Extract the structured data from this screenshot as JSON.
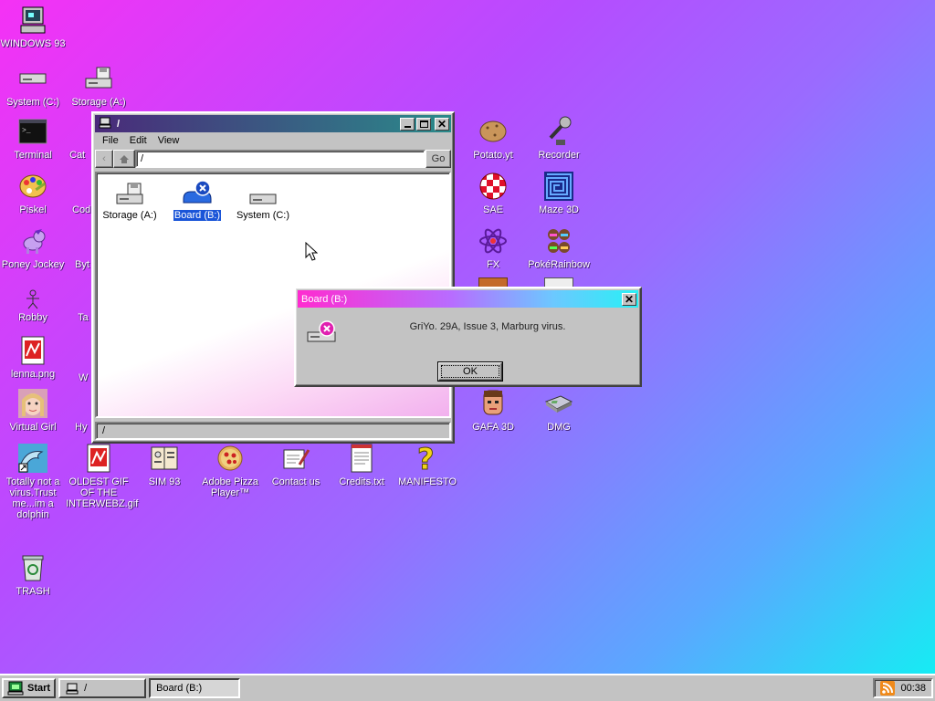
{
  "desktop": {
    "icons": [
      {
        "label": "WINDOWS 93",
        "icon": "computer-icon"
      },
      {
        "label": "System (C:)",
        "icon": "drive-icon"
      },
      {
        "label": "Storage (A:)",
        "icon": "floppy-drive-icon"
      },
      {
        "label": "Terminal",
        "icon": "terminal-icon"
      },
      {
        "label": "Cat",
        "icon": "cat-icon"
      },
      {
        "label": "Piskel",
        "icon": "palette-icon"
      },
      {
        "label": "Cod",
        "icon": "app-icon"
      },
      {
        "label": "Poney Jockey",
        "icon": "pony-icon"
      },
      {
        "label": "Byt",
        "icon": "app-icon"
      },
      {
        "label": "Robby",
        "icon": "stickman-icon"
      },
      {
        "label": "Ta",
        "icon": "app-icon"
      },
      {
        "label": "lenna.png",
        "icon": "image-file-icon"
      },
      {
        "label": "W",
        "icon": "app-icon"
      },
      {
        "label": "Virtual Girl",
        "icon": "face-icon"
      },
      {
        "label": "Hy",
        "icon": "app-icon"
      },
      {
        "label": "Totally not a virus.Trust me...im a dolphin",
        "icon": "dolphin-icon"
      },
      {
        "label": "OLDEST GIF OF THE INTERWEBZ.gif",
        "icon": "image-file-icon"
      },
      {
        "label": "SIM 93",
        "icon": "sim-icon"
      },
      {
        "label": "Adobe Pizza Player™",
        "icon": "pizza-icon"
      },
      {
        "label": "Contact us",
        "icon": "letter-icon"
      },
      {
        "label": "Credits.txt",
        "icon": "text-file-icon"
      },
      {
        "label": "MANIFESTO",
        "icon": "question-icon"
      },
      {
        "label": "TRASH",
        "icon": "trash-icon"
      },
      {
        "label": "Potato.yt",
        "icon": "potato-icon"
      },
      {
        "label": "Recorder",
        "icon": "microphone-icon"
      },
      {
        "label": "SAE",
        "icon": "ball-icon"
      },
      {
        "label": "Maze 3D",
        "icon": "maze-icon"
      },
      {
        "label": "FX",
        "icon": "atom-icon"
      },
      {
        "label": "PokéRainbow",
        "icon": "pokemon-icon"
      },
      {
        "label": "GAFA 3D",
        "icon": "face-icon"
      },
      {
        "label": "DMG",
        "icon": "gameboy-icon"
      }
    ]
  },
  "explorer": {
    "title": "/",
    "menu": [
      "File",
      "Edit",
      "View"
    ],
    "address": "/",
    "go_label": "Go",
    "items": [
      {
        "label": "Storage (A:)",
        "icon": "floppy-drive-icon",
        "selected": false
      },
      {
        "label": "Board (B:)",
        "icon": "board-error-icon",
        "selected": true
      },
      {
        "label": "System (C:)",
        "icon": "drive-icon",
        "selected": false
      }
    ],
    "status": "/"
  },
  "dialog": {
    "title": "Board (B:)",
    "message": "GriYo. 29A, Issue 3, Marburg virus.",
    "ok_label": "OK"
  },
  "taskbar": {
    "start_label": "Start",
    "tasks": [
      {
        "label": "/",
        "active": false
      },
      {
        "label": "Board (B:)",
        "active": true
      }
    ],
    "clock": "00:38"
  },
  "colors": {
    "explorer_title_gradient": [
      "#4a2a7a",
      "#2a8a8a"
    ],
    "dialog_title_gradient": [
      "#ff2bd0",
      "#28f0f5"
    ],
    "selection": "#1a55d8"
  }
}
